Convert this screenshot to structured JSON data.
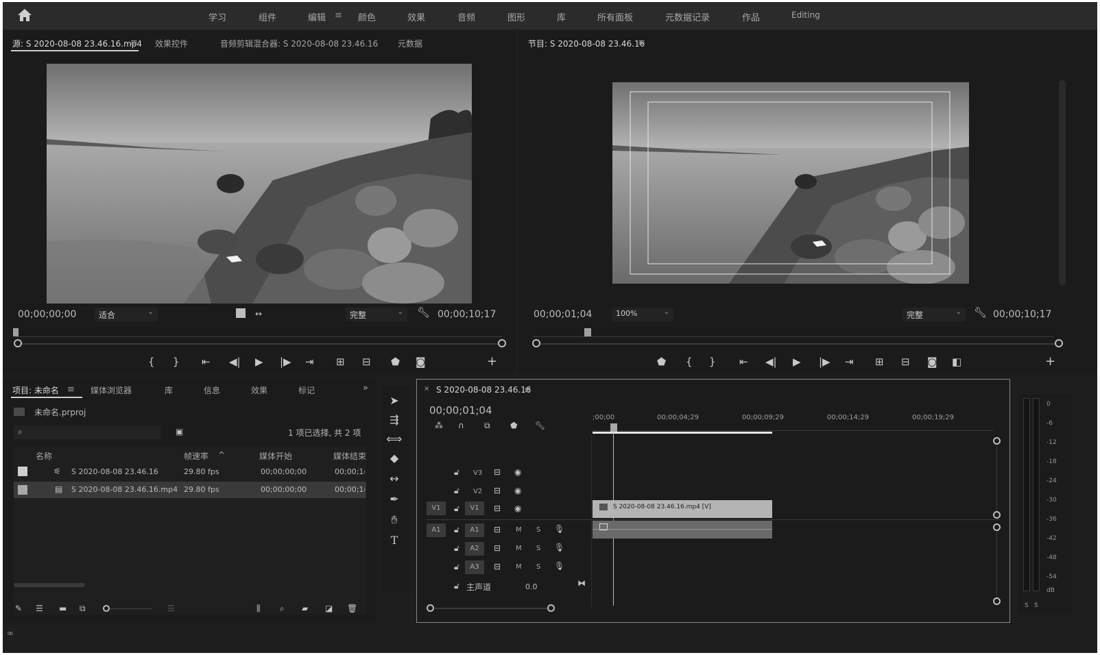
{
  "workspaces": [
    "学习",
    "组件",
    "编辑",
    "颜色",
    "效果",
    "音频",
    "图形",
    "库",
    "所有面板",
    "元数据记录",
    "作品",
    "Editing"
  ],
  "source_panel": {
    "tabs": [
      "源: S 2020-08-08 23.46.16.mp4",
      "效果控件",
      "音频剪辑混合器: S 2020-08-08 23.46.16",
      "元数据"
    ],
    "timecode_left": "00;00;00;00",
    "fit_label": "适合",
    "quality_label": "完整",
    "timecode_right": "00;00;10;17"
  },
  "program_panel": {
    "tab": "节目: S 2020-08-08 23.46.16",
    "timecode_left": "00;00;01;04",
    "zoom_label": "100%",
    "quality_label": "完整",
    "timecode_right": "00;00;10;17"
  },
  "project_panel": {
    "tabs": [
      "项目: 未命名",
      "媒体浏览器",
      "库",
      "信息",
      "效果",
      "标记"
    ],
    "project_file": "未命名.prproj",
    "selection_info": "1 项已选择, 共 2 项",
    "columns": [
      "名称",
      "帧速率",
      "媒体开始",
      "媒体结束"
    ],
    "rows": [
      {
        "name": "S 2020-08-08 23.46.16",
        "fps": "29.80 fps",
        "start": "00;00;00;00",
        "end": "00;00;1("
      },
      {
        "name": "S 2020-08-08 23.46.16.mp4",
        "fps": "29.80 fps",
        "start": "00;00;00;00",
        "end": "00;00;1("
      }
    ]
  },
  "timeline": {
    "tab": "S 2020-08-08 23.46.16",
    "timecode": "00;00;01;04",
    "ruler": [
      ";00;00",
      "00;00;04;29",
      "00;00;09;29",
      "00;00;14;29",
      "00;00;19;29"
    ],
    "video_tracks": [
      "V3",
      "V2",
      "V1"
    ],
    "audio_tracks": [
      "A1",
      "A2",
      "A3"
    ],
    "source_v": "V1",
    "source_a": "A1",
    "mute_label": "M",
    "solo_label": "S",
    "master_label": "主声道",
    "master_value": "0.0",
    "clip_label": "S 2020-08-08 23.46.16.mp4 [V]"
  },
  "meter": {
    "scale": [
      "0",
      "-6",
      "-12",
      "-18",
      "-24",
      "-30",
      "-36",
      "-42",
      "-48",
      "-54",
      "dB"
    ],
    "solo": [
      "S",
      "S"
    ]
  },
  "icons": [
    "home-icon",
    "hamburger-icon",
    "wrench-icon",
    "play-icon",
    "camera-icon",
    "search-icon",
    "lock-icon",
    "eye-icon",
    "mic-icon",
    "selection-tool-icon",
    "track-select-icon",
    "ripple-edit-icon",
    "razor-icon",
    "slip-icon",
    "pen-icon",
    "hand-icon",
    "type-icon",
    "trash-icon",
    "new-bin-icon",
    "creative-cloud-icon"
  ]
}
